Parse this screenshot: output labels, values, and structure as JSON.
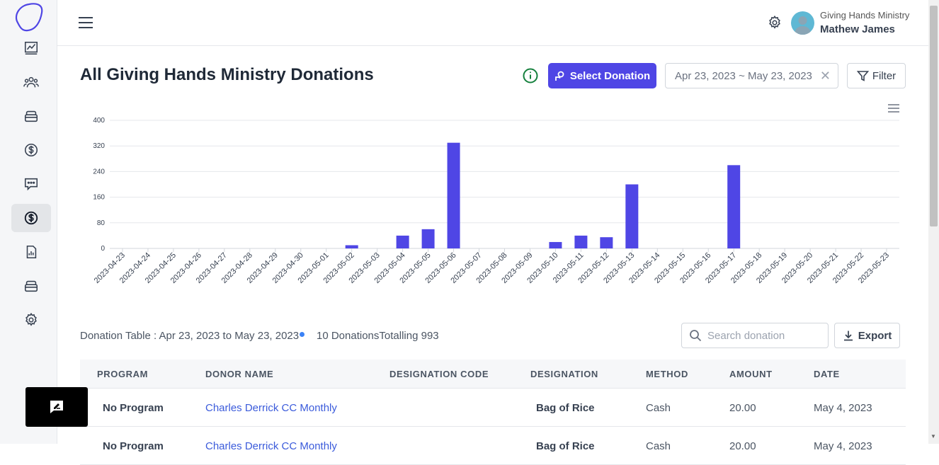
{
  "header": {
    "org_name": "Giving Hands Ministry",
    "user_name": "Mathew James"
  },
  "page": {
    "title": "All Giving Hands Ministry Donations",
    "select_donation_label": "Select Donation",
    "date_range": "Apr 23, 2023 ~ May 23, 2023",
    "filter_label": "Filter"
  },
  "chart_data": {
    "type": "bar",
    "categories": [
      "2023-04-23",
      "2023-04-24",
      "2023-04-25",
      "2023-04-26",
      "2023-04-27",
      "2023-04-28",
      "2023-04-29",
      "2023-04-30",
      "2023-05-01",
      "2023-05-02",
      "2023-05-03",
      "2023-05-04",
      "2023-05-05",
      "2023-05-06",
      "2023-05-07",
      "2023-05-08",
      "2023-05-09",
      "2023-05-10",
      "2023-05-11",
      "2023-05-12",
      "2023-05-13",
      "2023-05-14",
      "2023-05-15",
      "2023-05-16",
      "2023-05-17",
      "2023-05-18",
      "2023-05-19",
      "2023-05-20",
      "2023-05-21",
      "2023-05-22",
      "2023-05-23"
    ],
    "values": [
      0,
      0,
      0,
      0,
      0,
      0,
      0,
      0,
      0,
      10,
      0,
      40,
      60,
      330,
      0,
      0,
      0,
      20,
      40,
      35,
      200,
      0,
      0,
      0,
      260,
      0,
      0,
      0,
      0,
      0,
      0
    ],
    "y_ticks": [
      "400",
      "320",
      "240",
      "160",
      "80",
      "0"
    ],
    "ylim": [
      0,
      400
    ],
    "grid": true,
    "bar_color": "#4f46e5"
  },
  "table": {
    "caption": "Donation Table : Apr 23, 2023 to May 23, 2023",
    "count_text": "10 DonationsTotalling 993",
    "search_placeholder": "Search donation",
    "export_label": "Export",
    "headers": [
      "PROGRAM",
      "DONOR NAME",
      "DESIGNATION CODE",
      "DESIGNATION",
      "METHOD",
      "AMOUNT",
      "DATE"
    ],
    "rows": [
      {
        "program": "No Program",
        "donor": "Charles Derrick CC Monthly",
        "code": "",
        "designation": "Bag of Rice",
        "method": "Cash",
        "amount": "20.00",
        "date": "May 4, 2023"
      },
      {
        "program": "No Program",
        "donor": "Charles Derrick CC Monthly",
        "code": "",
        "designation": "Bag of Rice",
        "method": "Cash",
        "amount": "20.00",
        "date": "May 4, 2023"
      }
    ]
  },
  "colors": {
    "accent": "#4f46e5",
    "link": "#3b5bdb",
    "info": "#15803d"
  },
  "icons": {
    "sidebar": [
      "chart-icon",
      "people-icon",
      "inbox-icon",
      "dollar-icon",
      "chat-icon",
      "dollar-icon",
      "report-icon",
      "inbox-icon",
      "gear-icon"
    ]
  }
}
